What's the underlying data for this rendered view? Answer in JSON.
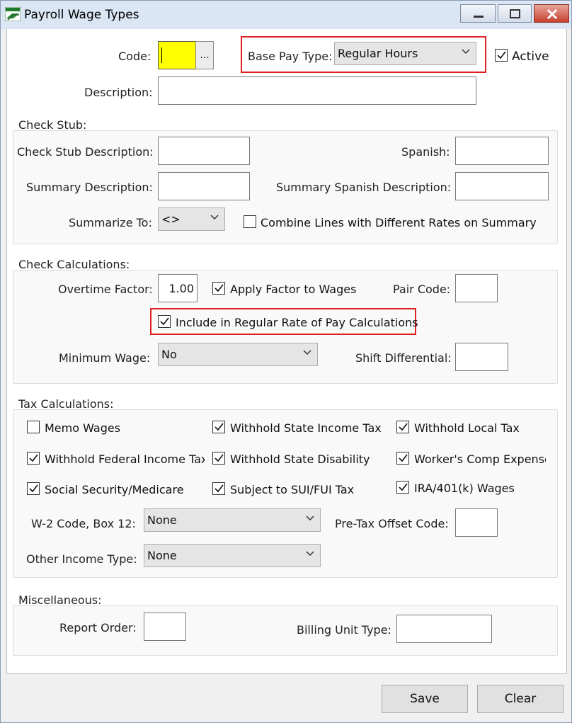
{
  "window": {
    "title": "Payroll Wage Types"
  },
  "header": {
    "code_label": "Code:",
    "code_value": "",
    "lookup_button": "...",
    "base_pay_type_label": "Base Pay Type:",
    "base_pay_type_value": "Regular Hours",
    "active_label": "Active",
    "active_checked": true,
    "description_label": "Description:",
    "description_value": ""
  },
  "check_stub": {
    "title": "Check Stub:",
    "check_stub_description_label": "Check Stub Description:",
    "spanish_label": "Spanish:",
    "summary_description_label": "Summary Description:",
    "summary_spanish_label": "Summary Spanish Description:",
    "summarize_to_label": "Summarize To:",
    "summarize_to_value": "<>",
    "combine_lines_label": "Combine Lines with Different Rates on Summary",
    "combine_lines_checked": false
  },
  "check_calc": {
    "title": "Check Calculations:",
    "overtime_factor_label": "Overtime Factor:",
    "overtime_factor_value": "1.00",
    "apply_factor_label": "Apply Factor to Wages",
    "pair_code_label": "Pair Code:",
    "include_regular_rate_label": "Include in Regular Rate of Pay Calculations",
    "minimum_wage_label": "Minimum Wage:",
    "minimum_wage_value": "No",
    "shift_differential_label": "Shift Differential:"
  },
  "tax": {
    "title": "Tax Calculations:",
    "memo_wages": "Memo Wages",
    "withhold_state_income": "Withhold State Income Tax",
    "withhold_local": "Withhold Local Tax",
    "withhold_federal": "Withhold Federal Income Tax",
    "withhold_state_disability": "Withhold State Disability",
    "workers_comp": "Worker's Comp Expense",
    "social_security": "Social Security/Medicare",
    "subject_sui_fui": "Subject to SUI/FUI Tax",
    "ira_401k": "IRA/401(k) Wages",
    "w2_code_label": "W-2 Code, Box 12:",
    "w2_code_value": "None",
    "pretax_offset_label": "Pre-Tax Offset Code:",
    "other_income_label": "Other Income Type:",
    "other_income_value": "None"
  },
  "misc": {
    "title": "Miscellaneous:",
    "report_order_label": "Report Order:",
    "billing_unit_label": "Billing Unit Type:"
  },
  "footer": {
    "save_label": "Save",
    "clear_label": "Clear"
  },
  "colors": {
    "code_field": "#ffff00",
    "highlight": "#e02020",
    "titlebar": "#dbe6f4"
  }
}
